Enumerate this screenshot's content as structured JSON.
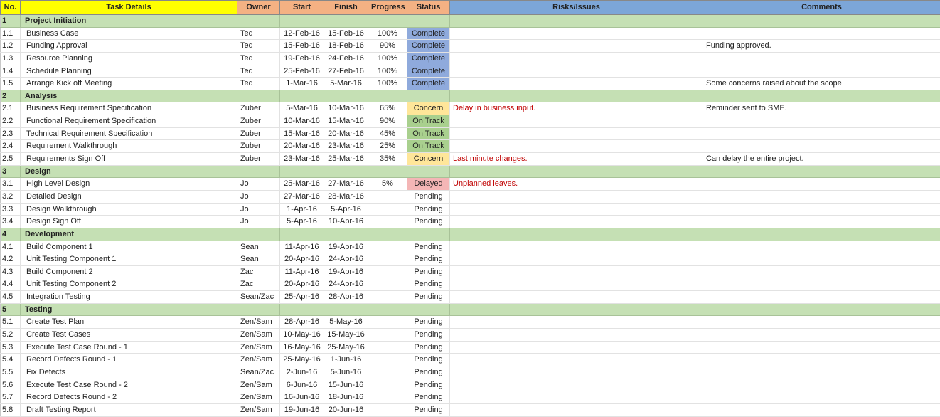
{
  "headers": {
    "no": "No.",
    "task": "Task Details",
    "owner": "Owner",
    "start": "Start",
    "finish": "Finish",
    "progress": "Progress",
    "status": "Status",
    "risks": "Risks/Issues",
    "comments": "Comments"
  },
  "status_styles": {
    "Complete": "s-Complete",
    "On Track": "s-OnTrack",
    "Concern": "s-Concern",
    "Delayed": "s-Delayed",
    "Pending": "s-Pending"
  },
  "sections": [
    {
      "no": "1",
      "title": "Project Initiation",
      "rows": [
        {
          "no": "1.1",
          "task": "Business Case",
          "owner": "Ted",
          "start": "12-Feb-16",
          "finish": "15-Feb-16",
          "progress": "100%",
          "status": "Complete",
          "risk": "",
          "comment": ""
        },
        {
          "no": "1.2",
          "task": "Funding Approval",
          "owner": "Ted",
          "start": "15-Feb-16",
          "finish": "18-Feb-16",
          "progress": "90%",
          "status": "Complete",
          "risk": "",
          "comment": "Funding approved."
        },
        {
          "no": "1.3",
          "task": "Resource Planning",
          "owner": "Ted",
          "start": "19-Feb-16",
          "finish": "24-Feb-16",
          "progress": "100%",
          "status": "Complete",
          "risk": "",
          "comment": ""
        },
        {
          "no": "1.4",
          "task": "Schedule Planning",
          "owner": "Ted",
          "start": "25-Feb-16",
          "finish": "27-Feb-16",
          "progress": "100%",
          "status": "Complete",
          "risk": "",
          "comment": ""
        },
        {
          "no": "1.5",
          "task": "Arrange Kick off Meeting",
          "owner": "Ted",
          "start": "1-Mar-16",
          "finish": "5-Mar-16",
          "progress": "100%",
          "status": "Complete",
          "risk": "",
          "comment": "Some concerns raised about the scope"
        }
      ]
    },
    {
      "no": "2",
      "title": "Analysis",
      "rows": [
        {
          "no": "2.1",
          "task": "Business Requirement Specification",
          "owner": "Zuber",
          "start": "5-Mar-16",
          "finish": "10-Mar-16",
          "progress": "65%",
          "status": "Concern",
          "risk": "Delay in business input.",
          "comment": "Reminder sent to SME."
        },
        {
          "no": "2.2",
          "task": "Functional Requirement Specification",
          "owner": "Zuber",
          "start": "10-Mar-16",
          "finish": "15-Mar-16",
          "progress": "90%",
          "status": "On Track",
          "risk": "",
          "comment": ""
        },
        {
          "no": "2.3",
          "task": "Technical Requirement Specification",
          "owner": "Zuber",
          "start": "15-Mar-16",
          "finish": "20-Mar-16",
          "progress": "45%",
          "status": "On Track",
          "risk": "",
          "comment": ""
        },
        {
          "no": "2.4",
          "task": "Requirement Walkthrough",
          "owner": "Zuber",
          "start": "20-Mar-16",
          "finish": "23-Mar-16",
          "progress": "25%",
          "status": "On Track",
          "risk": "",
          "comment": ""
        },
        {
          "no": "2.5",
          "task": "Requirements Sign Off",
          "owner": "Zuber",
          "start": "23-Mar-16",
          "finish": "25-Mar-16",
          "progress": "35%",
          "status": "Concern",
          "risk": "Last minute changes.",
          "comment": "Can delay the entire project."
        }
      ]
    },
    {
      "no": "3",
      "title": "Design",
      "rows": [
        {
          "no": "3.1",
          "task": "High Level Design",
          "owner": "Jo",
          "start": "25-Mar-16",
          "finish": "27-Mar-16",
          "progress": "5%",
          "status": "Delayed",
          "risk": "Unplanned leaves.",
          "comment": ""
        },
        {
          "no": "3.2",
          "task": "Detailed Design",
          "owner": "Jo",
          "start": "27-Mar-16",
          "finish": "28-Mar-16",
          "progress": "",
          "status": "Pending",
          "risk": "",
          "comment": ""
        },
        {
          "no": "3.3",
          "task": "Design Walkthrough",
          "owner": "Jo",
          "start": "1-Apr-16",
          "finish": "5-Apr-16",
          "progress": "",
          "status": "Pending",
          "risk": "",
          "comment": ""
        },
        {
          "no": "3.4",
          "task": "Design Sign Off",
          "owner": "Jo",
          "start": "5-Apr-16",
          "finish": "10-Apr-16",
          "progress": "",
          "status": "Pending",
          "risk": "",
          "comment": ""
        }
      ]
    },
    {
      "no": "4",
      "title": "Development",
      "rows": [
        {
          "no": "4.1",
          "task": "Build Component 1",
          "owner": "Sean",
          "start": "11-Apr-16",
          "finish": "19-Apr-16",
          "progress": "",
          "status": "Pending",
          "risk": "",
          "comment": ""
        },
        {
          "no": "4.2",
          "task": "Unit Testing Component 1",
          "owner": "Sean",
          "start": "20-Apr-16",
          "finish": "24-Apr-16",
          "progress": "",
          "status": "Pending",
          "risk": "",
          "comment": ""
        },
        {
          "no": "4.3",
          "task": "Build Component 2",
          "owner": "Zac",
          "start": "11-Apr-16",
          "finish": "19-Apr-16",
          "progress": "",
          "status": "Pending",
          "risk": "",
          "comment": ""
        },
        {
          "no": "4.4",
          "task": "Unit Testing Component 2",
          "owner": "Zac",
          "start": "20-Apr-16",
          "finish": "24-Apr-16",
          "progress": "",
          "status": "Pending",
          "risk": "",
          "comment": ""
        },
        {
          "no": "4.5",
          "task": "Integration Testing",
          "owner": "Sean/Zac",
          "start": "25-Apr-16",
          "finish": "28-Apr-16",
          "progress": "",
          "status": "Pending",
          "risk": "",
          "comment": ""
        }
      ]
    },
    {
      "no": "5",
      "title": "Testing",
      "rows": [
        {
          "no": "5.1",
          "task": "Create Test Plan",
          "owner": "Zen/Sam",
          "start": "28-Apr-16",
          "finish": "5-May-16",
          "progress": "",
          "status": "Pending",
          "risk": "",
          "comment": ""
        },
        {
          "no": "5.2",
          "task": "Create Test Cases",
          "owner": "Zen/Sam",
          "start": "10-May-16",
          "finish": "15-May-16",
          "progress": "",
          "status": "Pending",
          "risk": "",
          "comment": ""
        },
        {
          "no": "5.3",
          "task": "Execute Test Case Round - 1",
          "owner": "Zen/Sam",
          "start": "16-May-16",
          "finish": "25-May-16",
          "progress": "",
          "status": "Pending",
          "risk": "",
          "comment": ""
        },
        {
          "no": "5.4",
          "task": "Record Defects Round - 1",
          "owner": "Zen/Sam",
          "start": "25-May-16",
          "finish": "1-Jun-16",
          "progress": "",
          "status": "Pending",
          "risk": "",
          "comment": ""
        },
        {
          "no": "5.5",
          "task": "Fix Defects",
          "owner": "Sean/Zac",
          "start": "2-Jun-16",
          "finish": "5-Jun-16",
          "progress": "",
          "status": "Pending",
          "risk": "",
          "comment": ""
        },
        {
          "no": "5.6",
          "task": "Execute Test Case Round - 2",
          "owner": "Zen/Sam",
          "start": "6-Jun-16",
          "finish": "15-Jun-16",
          "progress": "",
          "status": "Pending",
          "risk": "",
          "comment": ""
        },
        {
          "no": "5.7",
          "task": "Record Defects Round - 2",
          "owner": "Zen/Sam",
          "start": "16-Jun-16",
          "finish": "18-Jun-16",
          "progress": "",
          "status": "Pending",
          "risk": "",
          "comment": ""
        },
        {
          "no": "5.8",
          "task": "Draft Testing Report",
          "owner": "Zen/Sam",
          "start": "19-Jun-16",
          "finish": "20-Jun-16",
          "progress": "",
          "status": "Pending",
          "risk": "",
          "comment": ""
        }
      ]
    }
  ]
}
